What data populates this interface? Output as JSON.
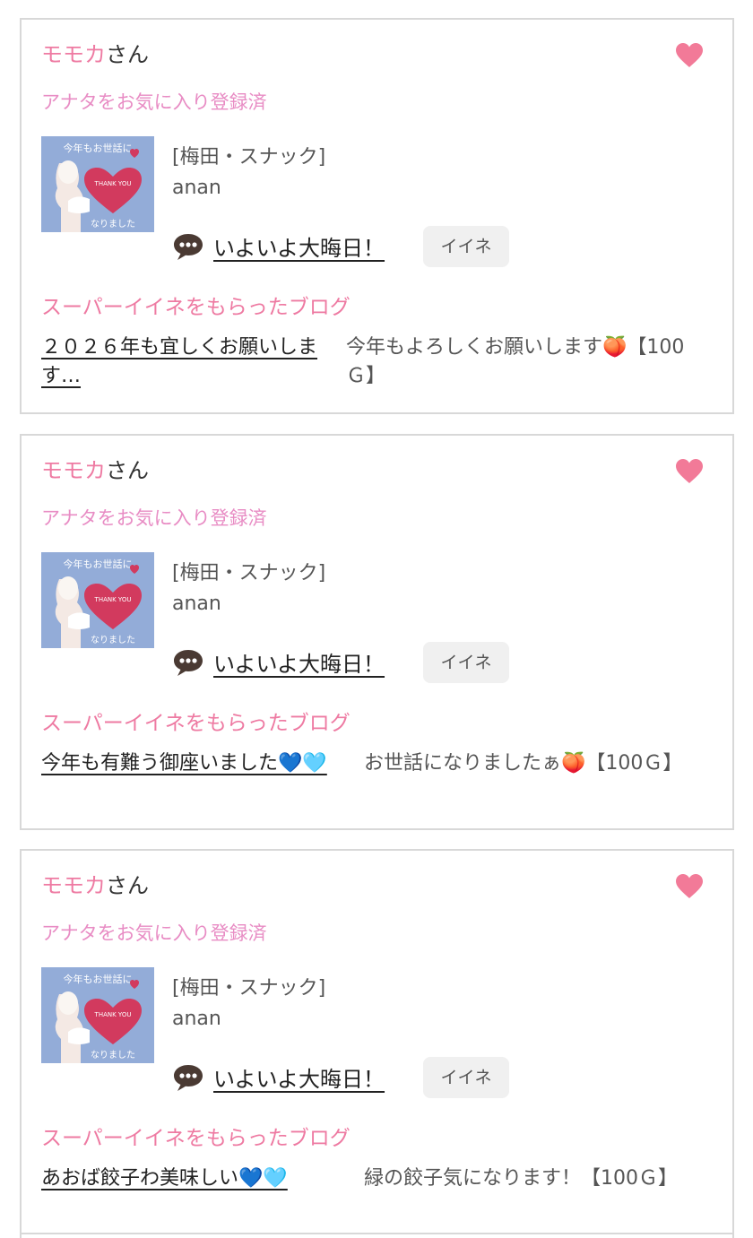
{
  "cards": [
    {
      "user_name": "モモカ",
      "user_suffix": "さん",
      "fav_status": "アナタをお気に入り登録済",
      "shop_category": "[梅田・スナック]",
      "shop_name": "anan",
      "blog_title": "いよいよ大晦日！",
      "iine_label": "イイネ",
      "super_heading": "スーパーイイネをもらったブログ",
      "got_blog_title": "２０２６年も宜しくお願いします…",
      "got_comment": "今年もよろしくお願いします🍑【100Ｇ】"
    },
    {
      "user_name": "モモカ",
      "user_suffix": "さん",
      "fav_status": "アナタをお気に入り登録済",
      "shop_category": "[梅田・スナック]",
      "shop_name": "anan",
      "blog_title": "いよいよ大晦日！",
      "iine_label": "イイネ",
      "super_heading": "スーパーイイネをもらったブログ",
      "got_blog_title": "今年も有難う御座いました💙🩵",
      "got_comment": "お世話になりましたぁ🍑【100Ｇ】"
    },
    {
      "user_name": "モモカ",
      "user_suffix": "さん",
      "fav_status": "アナタをお気に入り登録済",
      "shop_category": "[梅田・スナック]",
      "shop_name": "anan",
      "blog_title": "いよいよ大晦日！",
      "iine_label": "イイネ",
      "super_heading": "スーパーイイネをもらったブログ",
      "got_blog_title": "あおば餃子わ美味しい💙🩵",
      "got_comment": "緑の餃子気になります！【100Ｇ】"
    }
  ],
  "thumbnail": {
    "text_top": "今年もお世話に",
    "text_heart": "THANK YOU",
    "text_bottom": "なりました"
  },
  "colors": {
    "accent_pink": "#ee7aa2",
    "heart_pink": "#f27a98",
    "fav_pink": "#e88cc4",
    "thumb_bg": "#93acd8",
    "thumb_heart": "#d23a5e"
  },
  "icons": {
    "favorite": "heart-icon",
    "blog": "chat-bubble-icon"
  }
}
